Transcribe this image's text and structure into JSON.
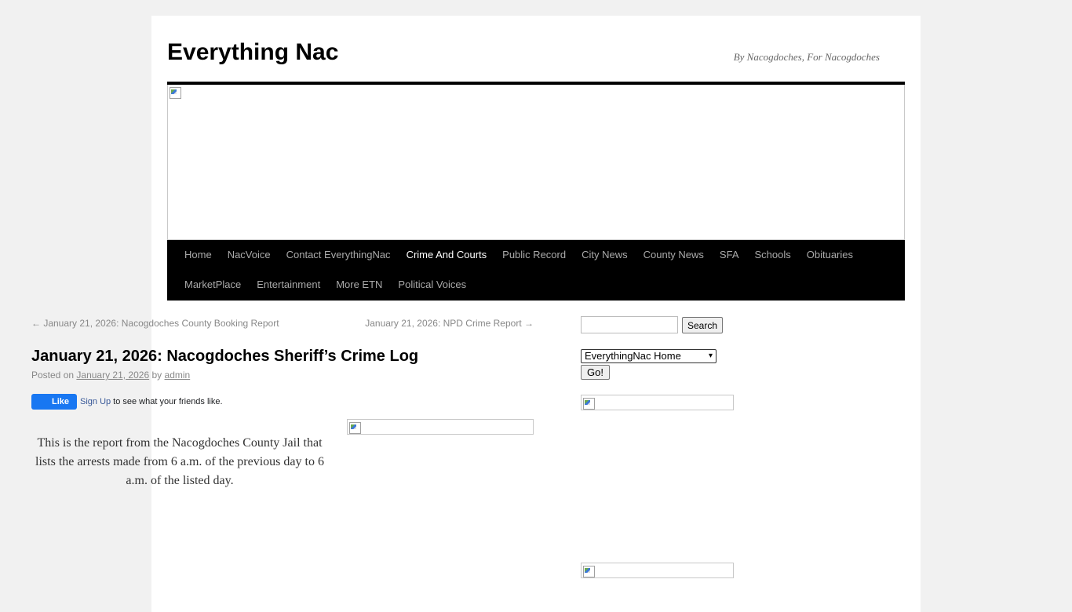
{
  "site": {
    "title": "Everything Nac",
    "description": "By Nacogdoches, For Nacogdoches"
  },
  "nav": {
    "row1": [
      "Home",
      "NacVoice",
      "Contact EverythingNac",
      "Crime And Courts",
      "Public Record",
      "City News",
      "County News",
      "SFA",
      "Schools",
      "Obituaries"
    ],
    "row2": [
      "MarketPlace",
      "Entertainment",
      "More ETN",
      "Political Voices"
    ],
    "active": "Crime And Courts"
  },
  "post_nav": {
    "prev": "← January 21, 2026: Nacogdoches County Booking Report",
    "next": "January 21, 2026: NPD Crime Report →"
  },
  "post": {
    "title": "January 21, 2026: Nacogdoches Sheriff’s Crime Log",
    "meta_prefix": "Posted on",
    "date": "January 21, 2026",
    "by": "by",
    "author": "admin",
    "body": "This is the report from the Nacogdoches County Jail that lists the arrests made from 6 a.m. of the previous day to 6 a.m. of the listed day."
  },
  "facebook": {
    "like_label": "Like",
    "signup_label": "Sign Up",
    "text": "to see what your friends like."
  },
  "sidebar": {
    "search_value": "",
    "search_button": "Search",
    "select_value": "EverythingNac Home",
    "go_button": "Go!"
  },
  "icons": {
    "broken_image": "broken-image-icon",
    "chevron": "chevron-down-icon"
  }
}
